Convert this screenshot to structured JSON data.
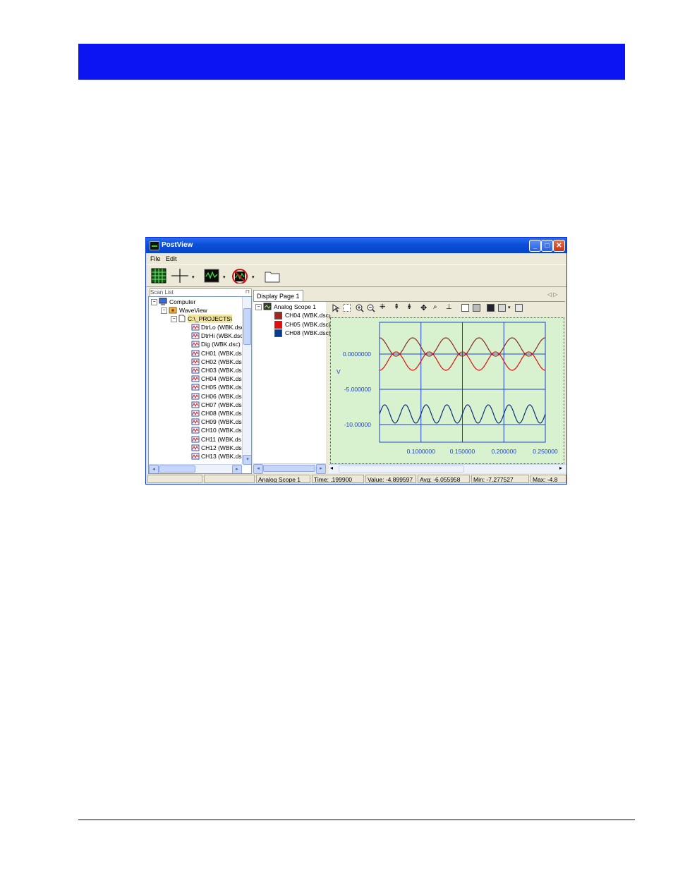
{
  "colors": {
    "banner": "#0a14f0",
    "window_title_bar": "#0a4fd8",
    "plot_background": "#d8f2d0",
    "grid": "#1d44c8"
  },
  "window": {
    "title": "PostView"
  },
  "menu": {
    "file": "File",
    "edit": "Edit"
  },
  "toolbar": {
    "icons": [
      "grid-icon",
      "cursor-crosshair-icon",
      "waveform-icon",
      "no-waveform-icon",
      "folder-icon"
    ]
  },
  "scan_list": {
    "header": "Scan List",
    "computer": "Computer",
    "waveview": "WaveView",
    "path": "C:\\_PROJECTS\\",
    "items": [
      "DtrLo (WBK.dsc",
      "DtrHi (WBK.dsc",
      "Dig (WBK.dsc)",
      "CH01 (WBK.ds",
      "CH02 (WBK.ds",
      "CH03 (WBK.ds",
      "CH04 (WBK.ds",
      "CH05 (WBK.ds",
      "CH06 (WBK.ds",
      "CH07 (WBK.ds",
      "CH08 (WBK.ds",
      "CH09 (WBK.ds",
      "CH10 (WBK.ds",
      "CH11 (WBK.ds",
      "CH12 (WBK.ds",
      "CH13 (WBK.ds"
    ]
  },
  "display": {
    "tab": "Display Page 1",
    "scope": "Analog Scope 1",
    "channels": [
      {
        "label": "CH04 (WBK.dsc)",
        "color": "#a0281c"
      },
      {
        "label": "CH05 (WBK.dsc)",
        "color": "#e01010"
      },
      {
        "label": "CH08 (WBK.dsc)",
        "color": "#0a3c8c"
      }
    ]
  },
  "chart_data": {
    "type": "line",
    "ylabel": "V",
    "xlabel": "",
    "x_ticks": [
      "0.1000000",
      "0.150000",
      "0.200000",
      "0.250000"
    ],
    "y_ticks": [
      "0.0000000",
      "-5.000000",
      "-10.00000"
    ],
    "xlim": [
      0.05,
      0.25
    ],
    "ylim": [
      -12.5,
      4.5
    ],
    "series": [
      {
        "name": "CH04 (WBK.dsc)",
        "color": "#8a2a20",
        "offset": 1.0,
        "amplitude": 1.3,
        "frequency": 25,
        "phase": 0.0
      },
      {
        "name": "CH05 (WBK.dsc)",
        "color": "#e01010",
        "offset": -1.0,
        "amplitude": 1.3,
        "frequency": 25,
        "phase": 3.1416
      },
      {
        "name": "CH08 (WBK.dsc)",
        "color": "#0a2f7a",
        "offset": -8.5,
        "amplitude": 1.3,
        "frequency": 40,
        "phase": 0.0
      }
    ]
  },
  "status": {
    "scope": "Analog Scope 1",
    "time": "Time: .199900",
    "value": "Value: -4.899597",
    "avg": "Avg: -6.055958",
    "min": "Min: -7.277527",
    "max": "Max: -4.8"
  }
}
